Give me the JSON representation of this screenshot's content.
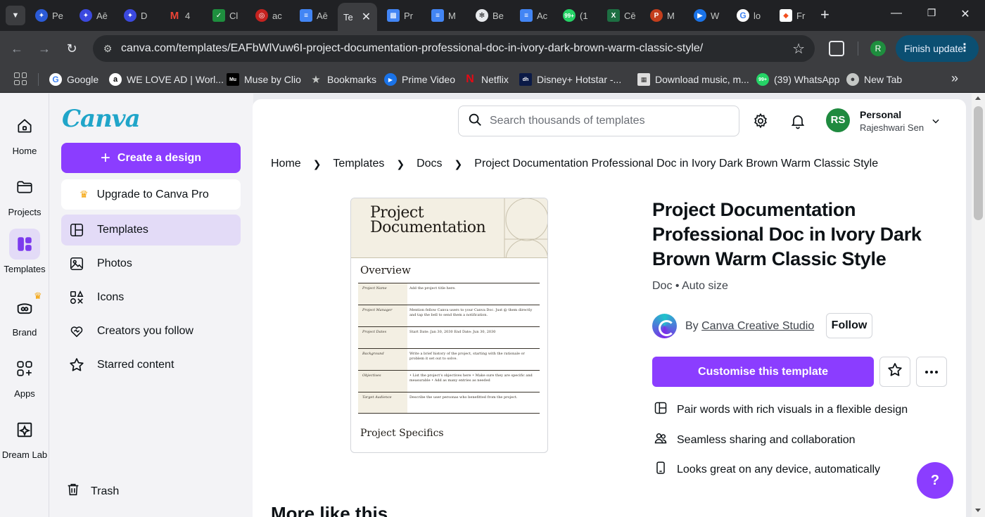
{
  "browser": {
    "tabs": [
      {
        "label": "Pe",
        "icon": "edge-blue-icon",
        "color": "#2b5bd7"
      },
      {
        "label": "Aē",
        "icon": "edge-blue-icon",
        "color": "#3b49df"
      },
      {
        "label": "D",
        "icon": "edge-blue-icon",
        "color": "#3b49df"
      },
      {
        "label": "4",
        "icon": "gmail-icon",
        "color": "#ea4335"
      },
      {
        "label": "Cl",
        "icon": "check-icon",
        "color": "#1e8e3e"
      },
      {
        "label": "ac",
        "icon": "target-icon",
        "color": "#c5221f"
      },
      {
        "label": "Aē",
        "icon": "docs-icon",
        "color": "#4285f4"
      },
      {
        "label": "Te",
        "icon": "canva-icon",
        "color": "#8b3dff"
      },
      {
        "label": "Pr",
        "icon": "slides-icon",
        "color": "#4285f4"
      },
      {
        "label": "M",
        "icon": "docs-icon",
        "color": "#4285f4"
      },
      {
        "label": "Be",
        "icon": "chatgpt-icon",
        "color": "#e8eaed"
      },
      {
        "label": "Ac",
        "icon": "docs-icon",
        "color": "#4285f4"
      },
      {
        "label": "(1",
        "icon": "whatsapp-icon",
        "color": "#25d366"
      },
      {
        "label": "Cē",
        "icon": "excel-icon",
        "color": "#1d6f42"
      },
      {
        "label": "M",
        "icon": "powerpoint-icon",
        "color": "#c43e1c"
      },
      {
        "label": "W",
        "icon": "play-icon",
        "color": "#1a73e8"
      },
      {
        "label": "lo",
        "icon": "google-icon",
        "color": "#ffffff"
      },
      {
        "label": "Fr",
        "icon": "figma-icon",
        "color": "#f24e1e"
      }
    ],
    "url": "canva.com/templates/EAFbWlVuw6I-project-documentation-professional-doc-in-ivory-dark-brown-warm-classic-style/",
    "profile_initial": "R",
    "finish_update_label": "Finish update",
    "bookmarks": [
      {
        "label": "Google",
        "icon": "google-icon"
      },
      {
        "label": "WE LOVE AD | Worl...",
        "icon": "a-letter-icon"
      },
      {
        "label": "Muse by Clio",
        "icon": "muse-icon"
      },
      {
        "label": "Bookmarks",
        "icon": "star-icon"
      },
      {
        "label": "Prime Video",
        "icon": "play-icon"
      },
      {
        "label": "Netflix",
        "icon": "netflix-icon"
      },
      {
        "label": "Disney+ Hotstar -...",
        "icon": "hotstar-icon"
      },
      {
        "label": "Download music, m...",
        "icon": "image-icon"
      },
      {
        "label": "(39) WhatsApp",
        "icon": "whatsapp-icon"
      },
      {
        "label": "New Tab",
        "icon": "globe-icon"
      }
    ]
  },
  "rail": {
    "home": "Home",
    "projects": "Projects",
    "templates": "Templates",
    "brand": "Brand",
    "apps": "Apps",
    "dream_lab": "Dream Lab"
  },
  "panel": {
    "logo": "Canva",
    "create_label": "Create a design",
    "upgrade_label": "Upgrade to Canva Pro",
    "nav": {
      "templates": "Templates",
      "photos": "Photos",
      "icons": "Icons",
      "creators": "Creators you follow",
      "starred": "Starred content"
    },
    "trash": "Trash"
  },
  "header": {
    "search_placeholder": "Search thousands of templates",
    "avatar_initials": "RS",
    "account_type": "Personal",
    "account_name": "Rajeshwari Sen"
  },
  "breadcrumb": [
    "Home",
    "Templates",
    "Docs",
    "Project Documentation Professional Doc in Ivory Dark Brown Warm Classic Style"
  ],
  "thumbnail": {
    "title_line1": "Project",
    "title_line2": "Documentation",
    "overview": "Overview",
    "rows": [
      {
        "key": "Project Name",
        "value": "Add the project title here."
      },
      {
        "key": "Project Manager",
        "value": "Mention fellow Canva users to your Canva Doc. Just @ them directly and tap the bell to send them a notification."
      },
      {
        "key": "Project Dates",
        "value": "Start Date: Jan 30, 2030   End Date: Jun 30, 2030"
      },
      {
        "key": "Background",
        "value": "Write a brief history of the project, starting with the rationale or problem it set out to solve."
      },
      {
        "key": "Objectives",
        "value": "• List the project's objectives here  • Make sure they are specific and measurable  • Add as many entries as needed"
      },
      {
        "key": "Target Audience",
        "value": "Describe the user personas who benefitted from the project."
      }
    ],
    "specifics": "Project Specifics"
  },
  "details": {
    "title": "Project Documentation Professional Doc in Ivory Dark Brown Warm Classic Style",
    "meta": "Doc • Auto size",
    "by_prefix": "By",
    "creator": "Canva Creative Studio",
    "follow_label": "Follow",
    "customise_label": "Customise this template",
    "features": [
      "Pair words with rich visuals in a flexible design",
      "Seamless sharing and collaboration",
      "Looks great on any device, automatically"
    ]
  },
  "more_like_this": "More like this",
  "help_label": "?",
  "colors": {
    "brand_purple": "#8b3dff",
    "active_nav": "#e3dbf7",
    "avatar_green": "#1f8a3f"
  }
}
